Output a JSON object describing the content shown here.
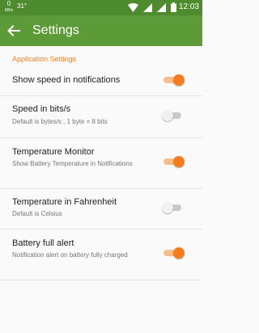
{
  "status_bar": {
    "speed_value": "0",
    "speed_unit": "KB/s",
    "temperature": "31°",
    "time": "12:03"
  },
  "app_bar": {
    "title": "Settings"
  },
  "section": {
    "title": "Application Settings"
  },
  "settings": [
    {
      "title": "Show speed in notifications",
      "subtitle": "",
      "enabled": true
    },
    {
      "title": "Speed in bits/s",
      "subtitle": "Default is bytes/s , 1 byte = 8 bits",
      "enabled": false
    },
    {
      "title": "Temperature Monitor",
      "subtitle": "Show Battery Temperature in Notifications",
      "enabled": true
    },
    {
      "title": "Temperature in Fahrenheit",
      "subtitle": "Default is Celsius",
      "enabled": false
    },
    {
      "title": "Battery full alert",
      "subtitle": "Notification alert on battery fully charged",
      "enabled": true
    }
  ],
  "colors": {
    "status_bar": "#4e8b2f",
    "app_bar": "#5c9b38",
    "accent": "#f57c20"
  }
}
